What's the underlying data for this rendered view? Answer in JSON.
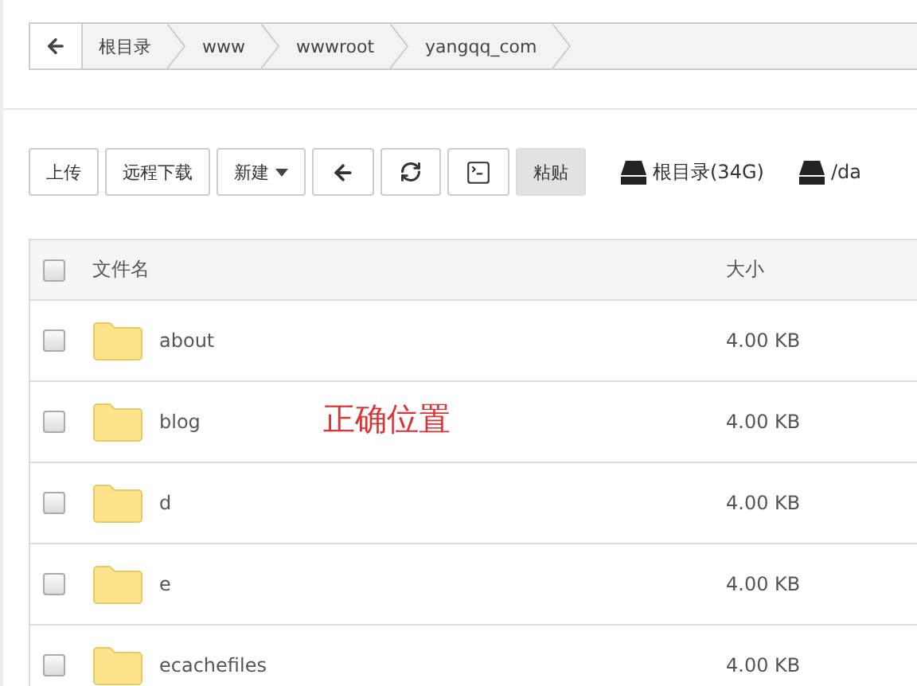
{
  "breadcrumb": {
    "items": [
      "根目录",
      "www",
      "wwwroot",
      "yangqq_com"
    ]
  },
  "toolbar": {
    "buttons": [
      {
        "kind": "text",
        "label": "上传",
        "highlighted": false
      },
      {
        "kind": "text",
        "label": "远程下载",
        "highlighted": false
      },
      {
        "kind": "dropdown",
        "label": "新建",
        "highlighted": false
      },
      {
        "kind": "back",
        "highlighted": false
      },
      {
        "kind": "refresh",
        "highlighted": false
      },
      {
        "kind": "terminal",
        "highlighted": false
      },
      {
        "kind": "text",
        "label": "粘贴",
        "highlighted": true
      }
    ],
    "disks": [
      "根目录(34G)",
      "/da"
    ]
  },
  "table": {
    "columns": [
      "文件名",
      "大小"
    ],
    "header_checked": false,
    "rows": [
      {
        "name": "about",
        "size": "4.00 KB",
        "checked": false
      },
      {
        "name": "blog",
        "size": "4.00 KB",
        "checked": false,
        "note": "正确位置"
      },
      {
        "name": "d",
        "size": "4.00 KB",
        "checked": false
      },
      {
        "name": "e",
        "size": "4.00 KB",
        "checked": false
      },
      {
        "name": "ecachefiles",
        "size": "4.00 KB",
        "checked": false
      }
    ]
  }
}
